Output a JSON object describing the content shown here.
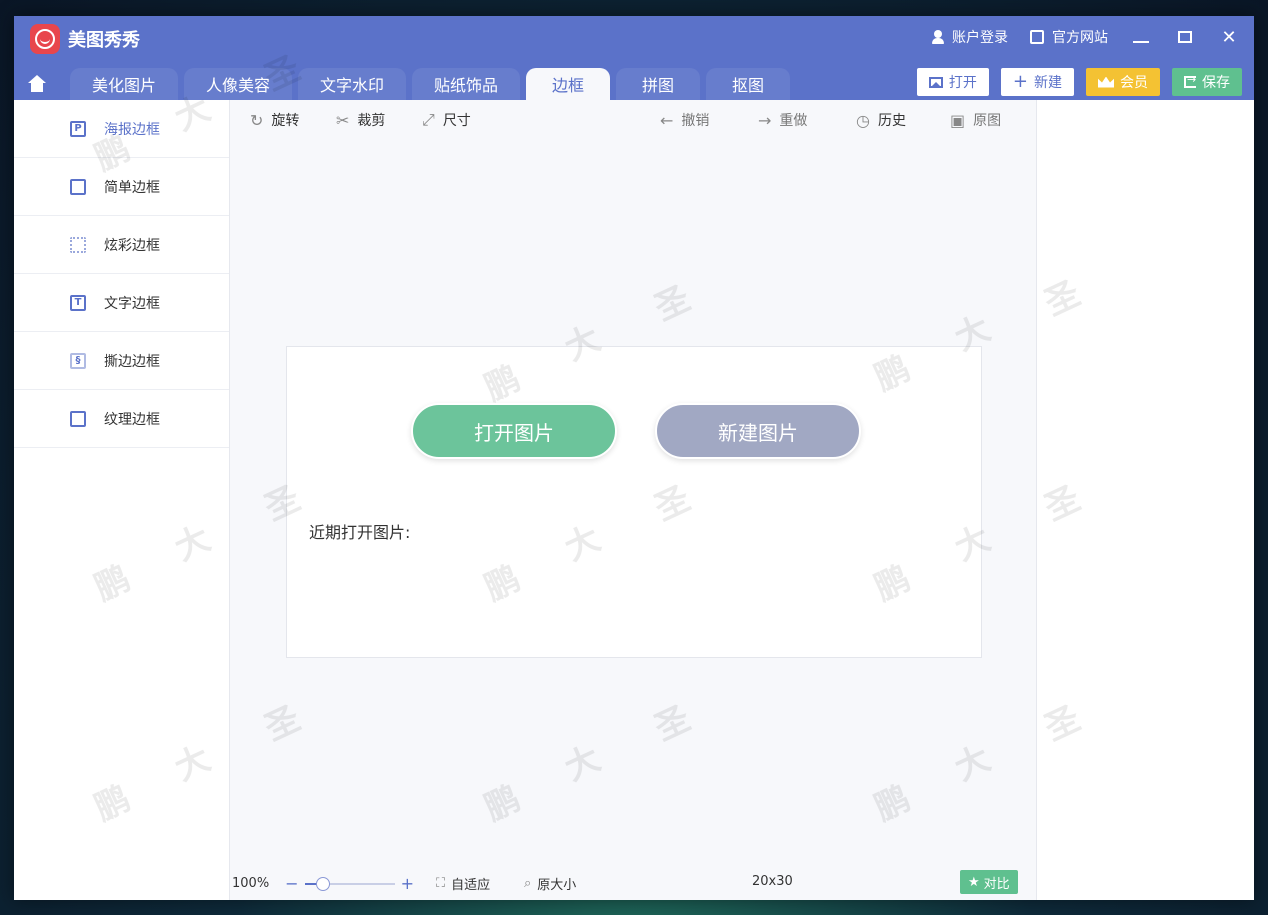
{
  "app": {
    "title": "美图秀秀",
    "account_label": "账户登录",
    "website_label": "官方网站"
  },
  "tabs": [
    {
      "label": "美化图片"
    },
    {
      "label": "人像美容"
    },
    {
      "label": "文字水印"
    },
    {
      "label": "贴纸饰品"
    },
    {
      "label": "边框",
      "active": true
    },
    {
      "label": "拼图"
    },
    {
      "label": "抠图"
    }
  ],
  "actions": {
    "open_label": "打开",
    "new_label": "新建",
    "vip_label": "会员",
    "save_label": "保存"
  },
  "sidebar": {
    "items": [
      {
        "label": "海报边框",
        "icon": "poster-frame-icon",
        "active": true
      },
      {
        "label": "简单边框",
        "icon": "simple-frame-icon"
      },
      {
        "label": "炫彩边框",
        "icon": "colorful-frame-icon"
      },
      {
        "label": "文字边框",
        "icon": "text-frame-icon"
      },
      {
        "label": "撕边边框",
        "icon": "torn-frame-icon"
      },
      {
        "label": "纹理边框",
        "icon": "texture-frame-icon"
      }
    ]
  },
  "toolbar": {
    "rotate": "旋转",
    "crop": "裁剪",
    "size": "尺寸",
    "undo": "撤销",
    "redo": "重做",
    "history": "历史",
    "original": "原图"
  },
  "start_panel": {
    "open_image": "打开图片",
    "new_image": "新建图片",
    "recent_label": "近期打开图片:"
  },
  "statusbar": {
    "zoom": "100%",
    "zoom_level": 0.2,
    "fit_label": "自适应",
    "actual_size_label": "原大小",
    "dimensions": "20x30",
    "compare_label": "对比"
  },
  "colors": {
    "brand": "#5b72c9",
    "green": "#6cc49b",
    "gray_button": "#a1a8c3",
    "gold": "#f4c233"
  }
}
